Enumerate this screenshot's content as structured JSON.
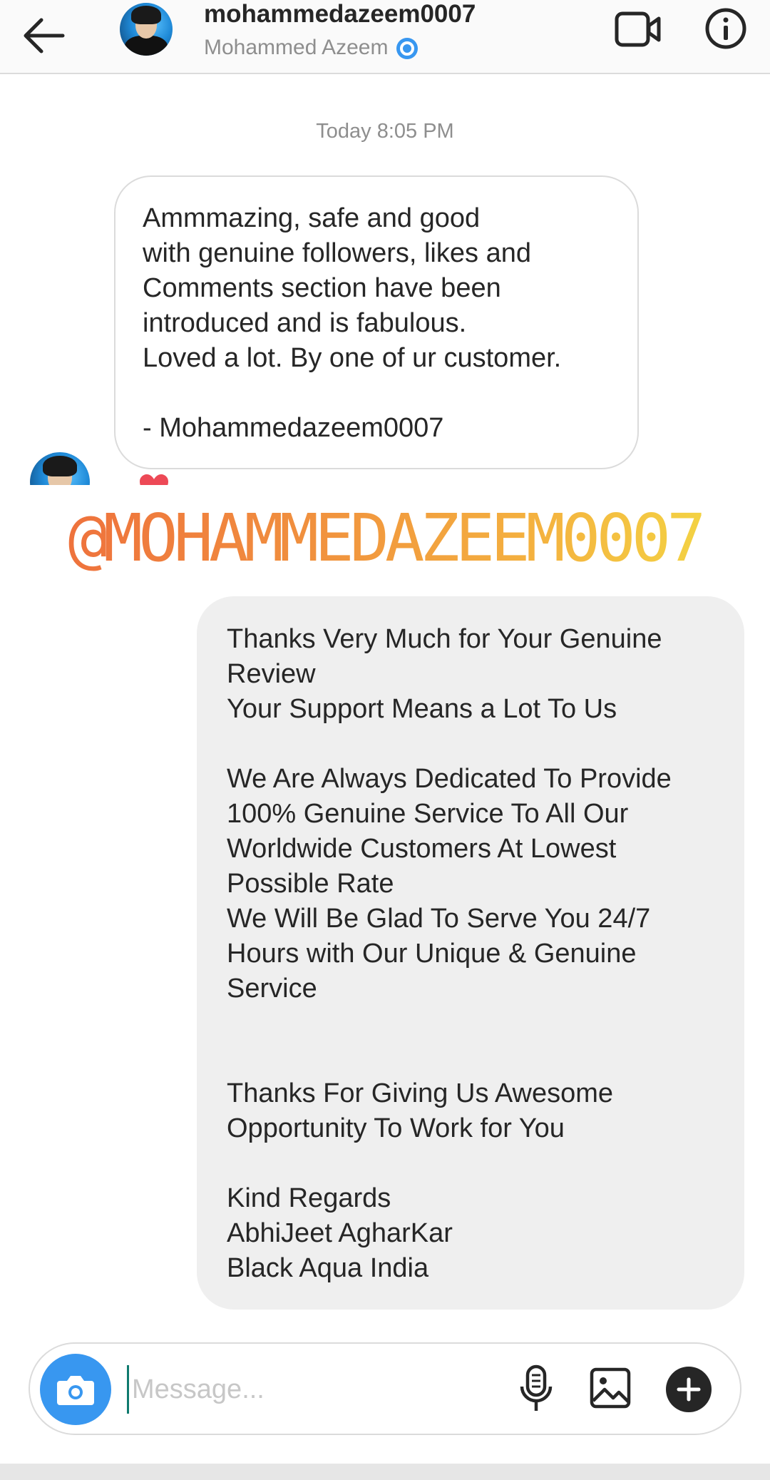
{
  "header": {
    "username": "mohammedazeem0007",
    "full_name": "Mohammed Azeem",
    "back_icon": "arrow-left-icon",
    "video_icon": "video-call-icon",
    "info_icon": "info-icon"
  },
  "thread": {
    "timestamp": "Today 8:05 PM",
    "received_message": "Ammmazing, safe and good\nwith genuine followers, likes and\nComments section have been\nintroduced and is fabulous.\nLoved a lot. By one of ur customer.\n\n- Mohammedazeem0007",
    "reaction_icon": "heart-icon",
    "sent_message": "Thanks Very Much for Your Genuine\nReview\nYour Support Means a Lot To Us\n\nWe Are Always Dedicated To Provide\n100% Genuine Service To All Our\nWorldwide Customers At Lowest\nPossible Rate\nWe Will Be Glad To Serve You 24/7\nHours with Our Unique & Genuine\nService\n\n\nThanks For Giving Us Awesome\nOpportunity To Work for You\n\nKind Regards\nAbhiJeet AgharKar\nBlack Aqua India"
  },
  "overlay": {
    "watermark": "@MOHAMMEDAZEEM0007"
  },
  "composer": {
    "placeholder": "Message...",
    "camera_icon": "camera-icon",
    "mic_icon": "microphone-icon",
    "gallery_icon": "gallery-icon",
    "add_icon": "plus-icon"
  },
  "colors": {
    "accent_blue": "#3897f0",
    "bubble_gray": "#efefef",
    "border": "#dbdbdb",
    "muted_text": "#8e8e8e",
    "heart_red": "#ed4956"
  }
}
